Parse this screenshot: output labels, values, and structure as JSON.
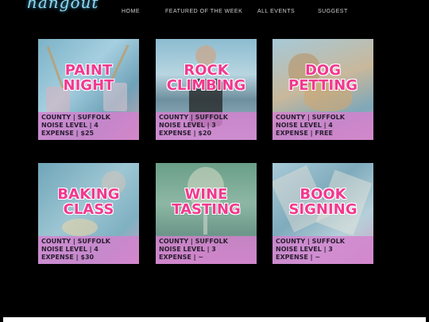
{
  "brand": {
    "logo_text": "hangout"
  },
  "nav": {
    "home": "HOME",
    "featured": "FEATURED OF THE WEEK",
    "all_events": "ALL EVENTS",
    "suggest": "SUGGEST"
  },
  "events": [
    {
      "title_line1": "PAINT",
      "title_line2": "NIGHT",
      "county": "COUNTY | SUFFOLK",
      "noise": "NOISE LEVEL | 4",
      "expense": "EXPENSE | $25"
    },
    {
      "title_line1": "ROCK",
      "title_line2": "CLIMBING",
      "county": "COUNTY | SUFFOLK",
      "noise": "NOISE LEVEL | 3",
      "expense": "EXPENSE | $20"
    },
    {
      "title_line1": "DOG",
      "title_line2": "PETTING",
      "county": "COUNTY | SUFFOLK",
      "noise": "NOISE LEVEL | 4",
      "expense": "EXPENSE | FREE"
    },
    {
      "title_line1": "BAKING",
      "title_line2": "CLASS",
      "county": "COUNTY | SUFFOLK",
      "noise": "NOISE LEVEL | 4",
      "expense": "EXPENSE | $30"
    },
    {
      "title_line1": "WINE",
      "title_line2": "TASTING",
      "county": "COUNTY | SUFFOLK",
      "noise": "NOISE LEVEL | 3",
      "expense": "EXPENSE | ~"
    },
    {
      "title_line1": "BOOK",
      "title_line2": "SIGNING",
      "county": "COUNTY | SUFFOLK",
      "noise": "NOISE LEVEL | 3",
      "expense": "EXPENSE | ~"
    }
  ],
  "colors": {
    "background": "#000000",
    "title_pink": "#f2398f",
    "info_band": "#d680ce",
    "logo_blue": "#8fd8f2"
  }
}
